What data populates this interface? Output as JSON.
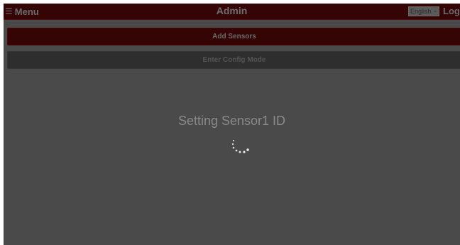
{
  "header": {
    "menu_icon": "☰",
    "menu_label": "Menu",
    "title": "Admin",
    "language": {
      "selected": "English",
      "caret": "⌄"
    },
    "logout_label": "Logout"
  },
  "actions": {
    "add_sensors_label": "Add Sensors",
    "config_mode_label": "Enter Config Mode"
  },
  "overlay": {
    "status_text": "Setting Sensor1 ID",
    "spinner_icon": "loading-spinner-icon"
  },
  "colors": {
    "header_bg": "#350505",
    "add_button_bg": "#350505",
    "config_button_bg": "#2e2e2e",
    "overlay_bg": "#4a4a4a"
  }
}
